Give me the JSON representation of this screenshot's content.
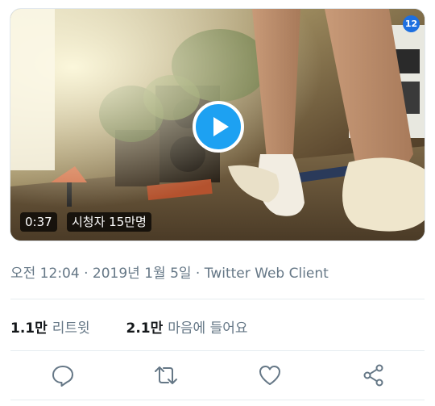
{
  "video": {
    "duration": "0:37",
    "views": "시청자 15만명",
    "badge": "12"
  },
  "meta": {
    "time": "오전 12:04",
    "separator": " · ",
    "date": "2019년 1월 5일",
    "client": "Twitter Web Client"
  },
  "stats": {
    "retweets_count": "1.1만",
    "retweets_label": "리트윗",
    "likes_count": "2.1만",
    "likes_label": "마음에 들어요"
  },
  "actions": {
    "reply": "reply-icon",
    "retweet": "retweet-icon",
    "like": "heart-icon",
    "share": "share-icon"
  },
  "colors": {
    "accent": "#1da1f2",
    "secondary_text": "#657786",
    "icon": "#657786"
  }
}
